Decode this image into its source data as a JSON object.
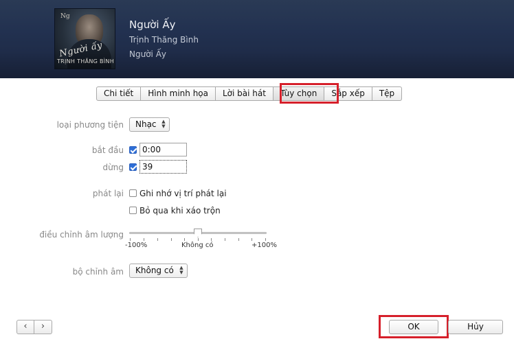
{
  "header": {
    "title": "Người Ấy",
    "artist": "Trịnh Thăng Bình",
    "album": "Người Ấy",
    "cover": {
      "script_text": "Người ấy",
      "artist_text": "TRỊNH THĂNG BÌNH"
    }
  },
  "tabs": [
    {
      "label": "Chi tiết",
      "active": false
    },
    {
      "label": "Hình minh họa",
      "active": false
    },
    {
      "label": "Lời bài hát",
      "active": false
    },
    {
      "label": "Tùy chọn",
      "active": true
    },
    {
      "label": "Sắp xếp",
      "active": false
    },
    {
      "label": "Tệp",
      "active": false
    }
  ],
  "options": {
    "media_type_label": "loại phương tiện",
    "media_type_value": "Nhạc",
    "start_label": "bắt đầu",
    "start_checked": true,
    "start_value": "0:00",
    "stop_label": "dừng",
    "stop_checked": true,
    "stop_value": "39",
    "playback_label": "phát lại",
    "remember_position_label": "Ghi nhớ vị trí phát lại",
    "remember_position_checked": false,
    "skip_shuffle_label": "Bỏ qua khi xáo trộn",
    "skip_shuffle_checked": false,
    "volume_label": "điều chỉnh âm lượng",
    "volume_value": 0,
    "volume_min_label": "-100%",
    "volume_mid_label": "Không có",
    "volume_max_label": "+100%",
    "equalizer_label": "bộ chỉnh âm",
    "equalizer_value": "Không có"
  },
  "footer": {
    "prev_icon": "‹",
    "next_icon": "›",
    "ok_label": "OK",
    "cancel_label": "Hủy"
  },
  "colors": {
    "highlight": "#d6202b",
    "checkbox_checked": "#2f6fd6"
  }
}
